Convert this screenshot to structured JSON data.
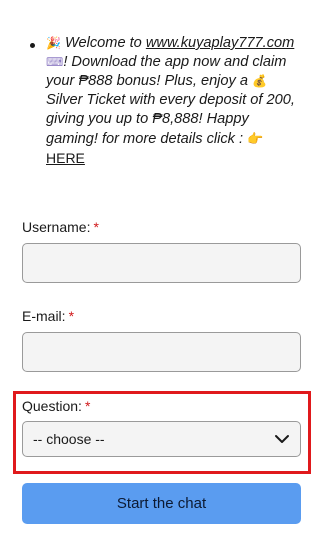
{
  "announcement": {
    "party_emoji": "🎉",
    "welcome": "Welcome to",
    "site_link": "www.kuyaplay777.com",
    "keyboard_emoji": "⌨",
    "text_part1": "! Download the app now and claim your ₱888 bonus! Plus, enjoy a",
    "money_emoji": "💰",
    "text_part2": "Silver Ticket with every deposit of 200, giving you up to ₱8,888! Happy gaming! for more details click :",
    "point_emoji": "👉",
    "here_link": "HERE"
  },
  "form": {
    "username_label": "Username:",
    "email_label": "E-mail:",
    "question_label": "Question:",
    "required_mark": "*",
    "question_selected": "-- choose --",
    "submit_label": "Start the chat"
  },
  "colors": {
    "required": "#d0181a",
    "highlight_frame": "#e0191c",
    "submit_bg": "#5a9cf0",
    "field_bg": "#f4f4f4"
  },
  "icons": {
    "select_arrow": "chevron-down-icon"
  }
}
